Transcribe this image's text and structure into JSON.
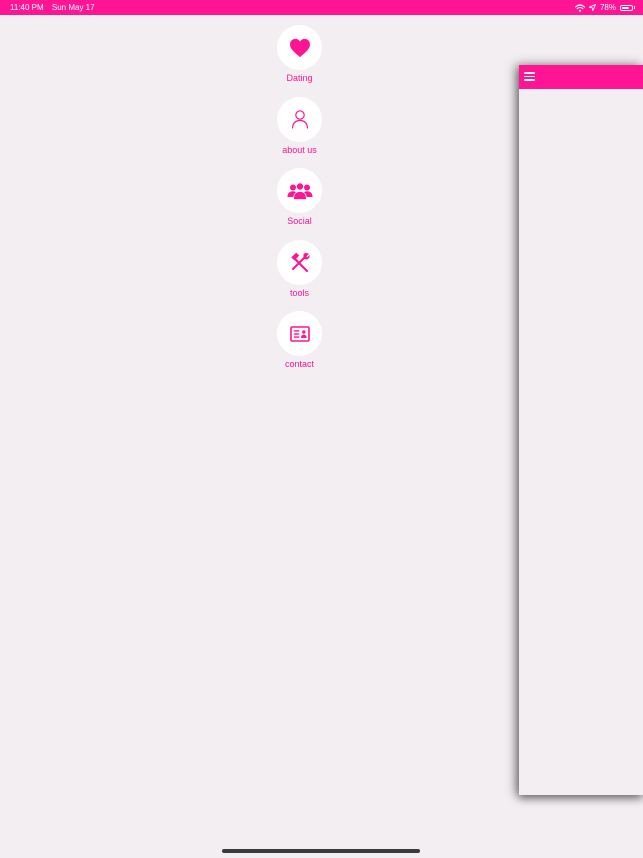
{
  "status_bar": {
    "time": "11:40 PM",
    "date": "Sun May 17",
    "battery": "78%",
    "battery_level": 0.78,
    "wifi_icon": "wifi-icon",
    "location_icon": "location-arrow-icon",
    "battery_icon": "battery-icon"
  },
  "menu": {
    "items": [
      {
        "label": "Dating",
        "icon": "heart-icon"
      },
      {
        "label": "about us",
        "icon": "person-outline-icon"
      },
      {
        "label": "Social",
        "icon": "group-icon"
      },
      {
        "label": "tools",
        "icon": "hammer-wrench-icon"
      },
      {
        "label": "contact",
        "icon": "contact-card-icon"
      }
    ]
  },
  "panel": {
    "menu_icon": "hamburger-menu-icon"
  },
  "colors": {
    "accent": "#ff1493",
    "background": "#f2eef1",
    "circle": "#ffffff"
  }
}
